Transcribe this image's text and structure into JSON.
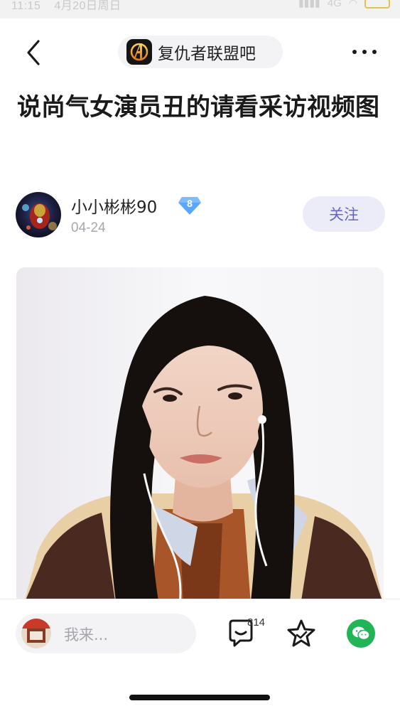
{
  "status_bar": {
    "time": "11:15",
    "date": "4月20日周日",
    "network": "4G"
  },
  "nav": {
    "forum_name": "复仇者联盟吧",
    "forum_logo_letter": "A"
  },
  "post": {
    "title": "说尚气女演员丑的请看采访视频图",
    "author": "小小彬彬90",
    "level": "8",
    "date": "04-24",
    "follow_label": "关注"
  },
  "bottom_bar": {
    "input_placeholder": "我来...",
    "comment_count": "814"
  },
  "colors": {
    "accent": "#6664c9",
    "follow_bg": "#ecebf8",
    "wechat": "#22b557",
    "badge": "#5aa7ff"
  }
}
